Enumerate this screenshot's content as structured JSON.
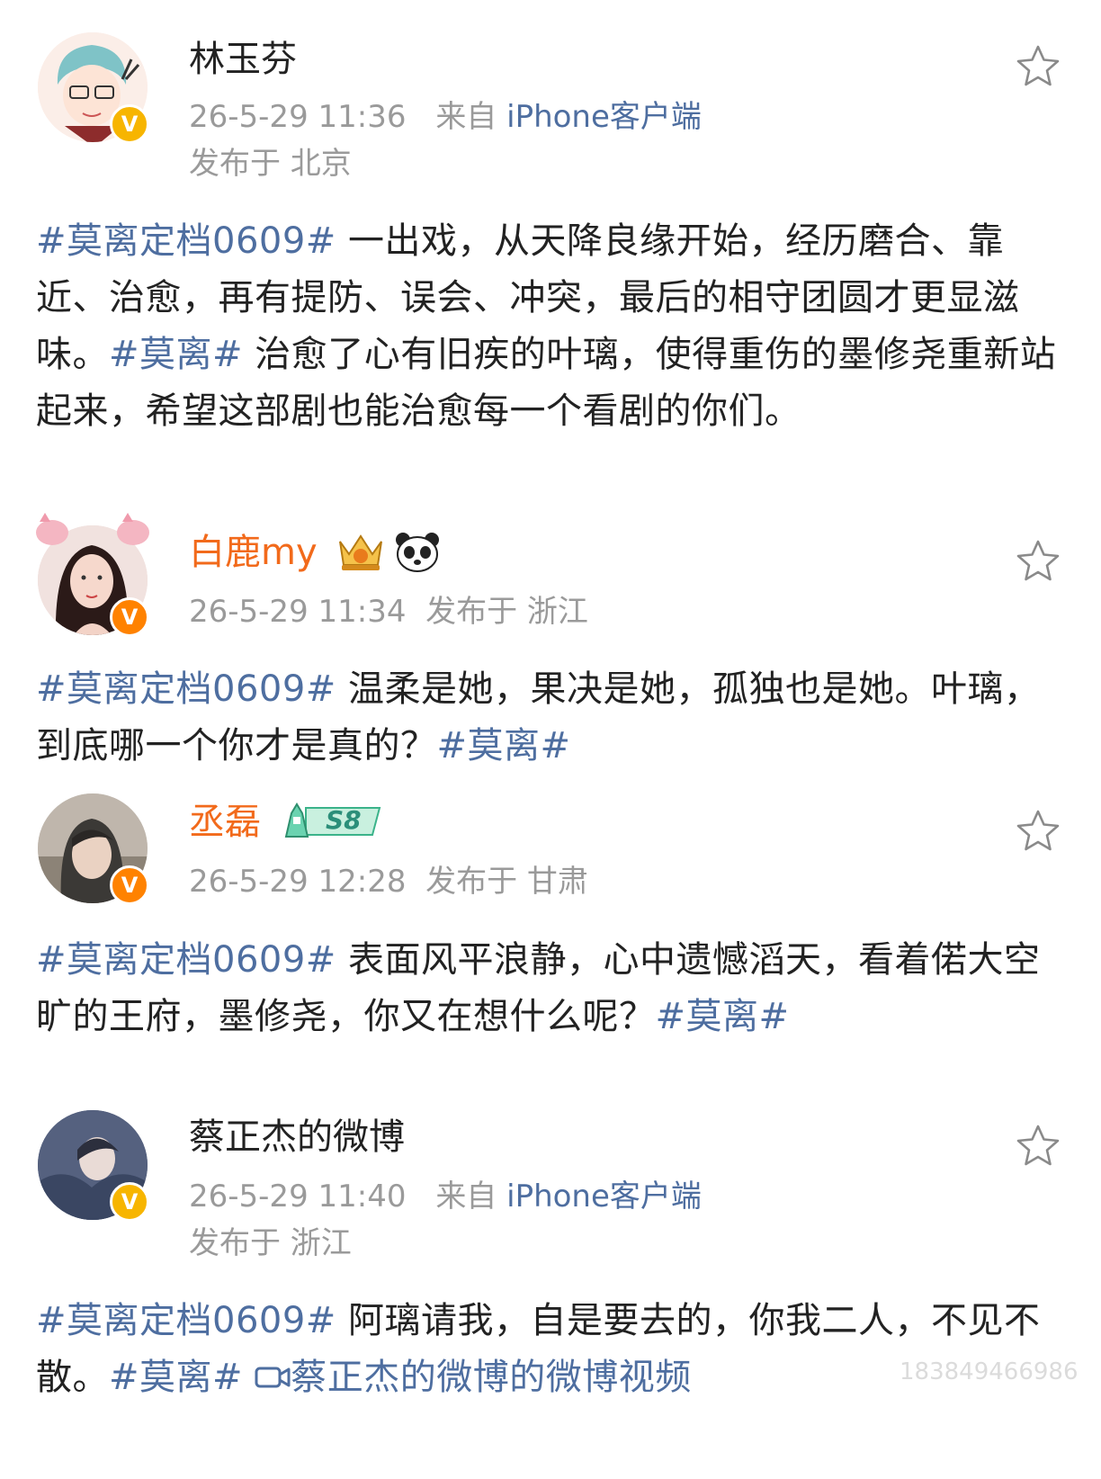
{
  "posts": [
    {
      "username": "林玉芬",
      "time": "26-5-29 11:36",
      "source_prefix": "来自",
      "source_client": "iPhone客户端",
      "location": "发布于 北京",
      "topic1": "#莫离定档0609#",
      "text1": " 一出戏，从天降良缘开始，经历磨合、靠近、治愈，再有提防、误会、冲突，最后的相守团圆才更显滋味。",
      "topic2": "#莫离#",
      "text2": " 治愈了心有旧疾的叶璃，使得重伤的墨修尧重新站起来，希望这部剧也能治愈每一个看剧的你们。"
    },
    {
      "username": "白鹿my",
      "meta": "26-5-29 11:34  发布于 浙江",
      "topic1": "#莫离定档0609#",
      "text1": " 温柔是她，果决是她，孤独也是她。叶璃，到底哪一个你才是真的？",
      "topic2": "#莫离#"
    },
    {
      "username": "丞磊",
      "level_badge": "S8",
      "meta": "26-5-29 12:28  发布于 甘肃",
      "topic1": "#莫离定档0609#",
      "text1": " 表面风平浪静，心中遗憾滔天，看着偌大空旷的王府，墨修尧，你又在想什么呢？",
      "topic2": "#莫离#"
    },
    {
      "username": "蔡正杰的微博",
      "time": "26-5-29 11:40",
      "source_prefix": "来自",
      "source_client": "iPhone客户端",
      "location": "发布于 浙江",
      "topic1": "#莫离定档0609#",
      "text1": " 阿璃请我，自是要去的，你我二人，不见不散。",
      "topic2": "#莫离#",
      "video_link": "蔡正杰的微博的微博视频"
    }
  ],
  "verified_mark": "V",
  "icons": {
    "star": "star-outline-icon",
    "video": "video-camera-icon",
    "panda": "panda-icon",
    "crown": "crown-badge-icon"
  },
  "colors": {
    "topic": "#4e6ea0",
    "vip_name": "#f26a1b",
    "meta": "#9a9a9a",
    "verified": "#f7b500"
  },
  "watermark": "183849466986"
}
